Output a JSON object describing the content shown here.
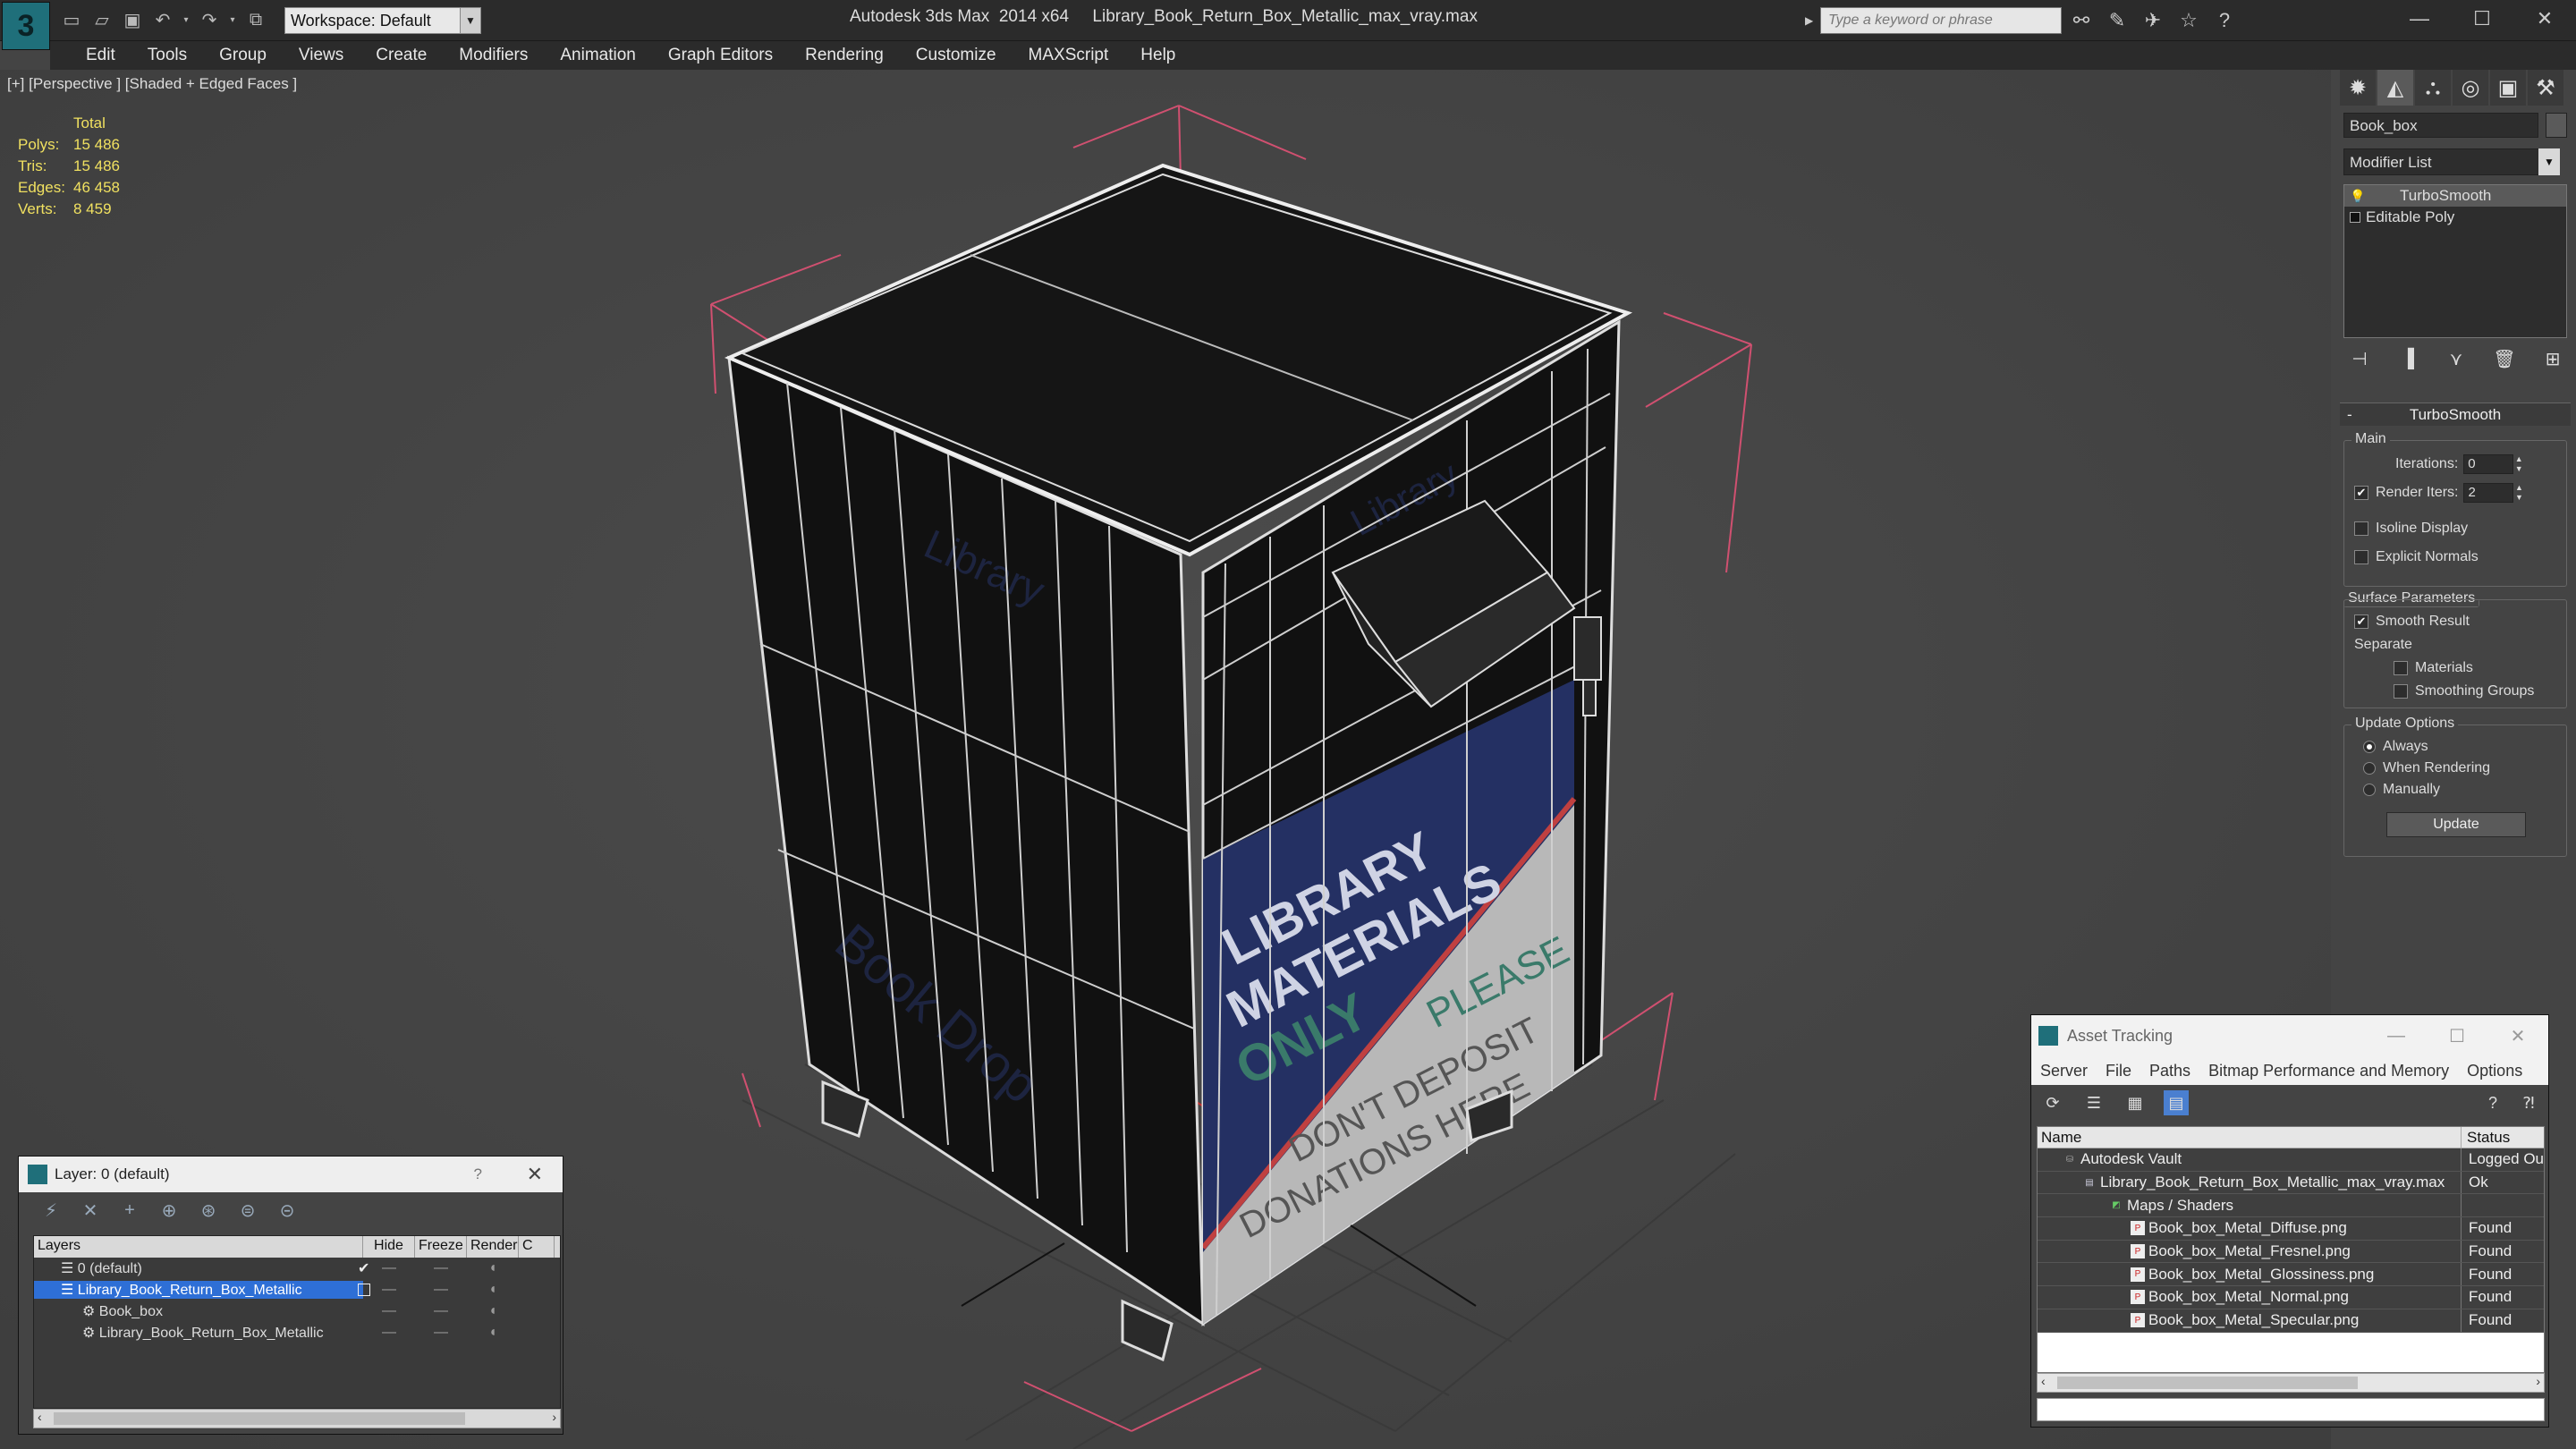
{
  "app": {
    "title": "Autodesk 3ds Max  2014 x64     Library_Book_Return_Box_Metallic_max_vray.max",
    "workspace": "Workspace: Default",
    "search_placeholder": "Type a keyword or phrase"
  },
  "menu": [
    "Edit",
    "Tools",
    "Group",
    "Views",
    "Create",
    "Modifiers",
    "Animation",
    "Graph Editors",
    "Rendering",
    "Customize",
    "MAXScript",
    "Help"
  ],
  "viewport": {
    "label": "[+] [Perspective ] [Shaded + Edged Faces ]",
    "stats": {
      "total_label": "Total",
      "rows": [
        {
          "k": "Polys:",
          "v": "15 486"
        },
        {
          "k": "Tris:",
          "v": "15 486"
        },
        {
          "k": "Edges:",
          "v": "46 458"
        },
        {
          "k": "Verts:",
          "v": "8 459"
        }
      ]
    },
    "decal": {
      "line1": "LIBRARY",
      "line2": "MATERIALS",
      "line3": "ONLY",
      "line4": "PLEASE",
      "line5": "DON'T DEPOSIT",
      "line6": "DONATIONS HERE",
      "side": "Library",
      "side2": "Book Drop",
      "top": "Library"
    }
  },
  "command_panel": {
    "object_name": "Book_box",
    "modifier_list": "Modifier List",
    "stack": [
      {
        "label": "TurboSmooth",
        "selected": true
      },
      {
        "label": "Editable Poly",
        "selected": false
      }
    ],
    "rollout": {
      "title": "TurboSmooth",
      "main_group": "Main",
      "iterations_label": "Iterations:",
      "iterations_value": "0",
      "render_iters_label": "Render Iters:",
      "render_iters_value": "2",
      "isoline": "Isoline Display",
      "explicit": "Explicit Normals",
      "surface_group": "Surface Parameters",
      "smooth_result": "Smooth Result",
      "separate": "Separate",
      "materials": "Materials",
      "smoothing_groups": "Smoothing Groups",
      "update_group": "Update Options",
      "always": "Always",
      "when_rendering": "When Rendering",
      "manually": "Manually",
      "update_btn": "Update"
    }
  },
  "layer_window": {
    "title": "Layer: 0 (default)",
    "help": "?",
    "columns": [
      "Layers",
      "Hide",
      "Freeze",
      "Render",
      "C"
    ],
    "rows": [
      {
        "name": "0 (default)",
        "indent": 0,
        "selected": false
      },
      {
        "name": "Library_Book_Return_Box_Metallic",
        "indent": 0,
        "selected": true
      },
      {
        "name": "Book_box",
        "indent": 1,
        "selected": false
      },
      {
        "name": "Library_Book_Return_Box_Metallic",
        "indent": 1,
        "selected": false
      }
    ]
  },
  "asset_tracking": {
    "title": "Asset Tracking",
    "menu": [
      "Server",
      "File",
      "Paths",
      "Bitmap Performance and Memory",
      "Options"
    ],
    "columns": {
      "name": "Name",
      "status": "Status"
    },
    "rows": [
      {
        "name": "Autodesk Vault",
        "status": "Logged Ou",
        "indent": 1,
        "icon": "vault"
      },
      {
        "name": "Library_Book_Return_Box_Metallic_max_vray.max",
        "status": "Ok",
        "indent": 2,
        "icon": "file"
      },
      {
        "name": "Maps / Shaders",
        "status": "",
        "indent": 3,
        "icon": "maps"
      },
      {
        "name": "Book_box_Metal_Diffuse.png",
        "status": "Found",
        "indent": 4,
        "icon": "png"
      },
      {
        "name": "Book_box_Metal_Fresnel.png",
        "status": "Found",
        "indent": 4,
        "icon": "png"
      },
      {
        "name": "Book_box_Metal_Glossiness.png",
        "status": "Found",
        "indent": 4,
        "icon": "png"
      },
      {
        "name": "Book_box_Metal_Normal.png",
        "status": "Found",
        "indent": 4,
        "icon": "png"
      },
      {
        "name": "Book_box_Metal_Specular.png",
        "status": "Found",
        "indent": 4,
        "icon": "png"
      }
    ]
  }
}
